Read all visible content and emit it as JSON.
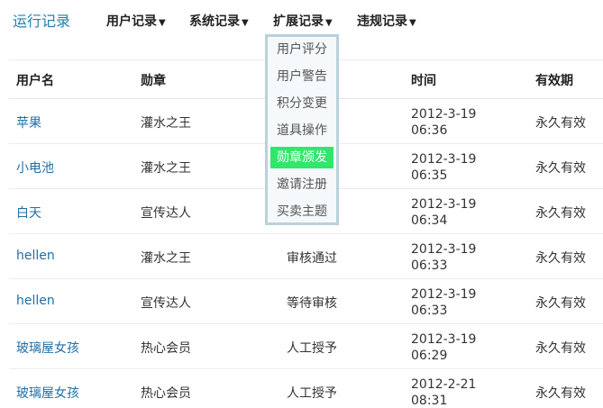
{
  "header": {
    "title": "运行记录",
    "nav": [
      {
        "label": "用户记录",
        "caret": "▼"
      },
      {
        "label": "系统记录",
        "caret": "▼"
      },
      {
        "label": "扩展记录",
        "caret": "▼"
      },
      {
        "label": "违规记录",
        "caret": "▼"
      }
    ]
  },
  "dropdown": {
    "items": [
      "用户评分",
      "用户警告",
      "积分变更",
      "道具操作",
      "勋章颁发",
      "邀请注册",
      "买卖主题"
    ],
    "active": "勋章颁发"
  },
  "table": {
    "columns": [
      "用户名",
      "勋章",
      "",
      "时间",
      "有效期"
    ],
    "rows": [
      {
        "user": "苹果",
        "medal": "灌水之王",
        "op": "",
        "date": "2012-3-19",
        "time": "06:36",
        "valid": "永久有效"
      },
      {
        "user": "小电池",
        "medal": "灌水之王",
        "op": "",
        "date": "2012-3-19",
        "time": "06:35",
        "valid": "永久有效"
      },
      {
        "user": "白天",
        "medal": "宣传达人",
        "op": "",
        "date": "2012-3-19",
        "time": "06:34",
        "valid": "永久有效"
      },
      {
        "user": "hellen",
        "medal": "灌水之王",
        "op": "审核通过",
        "date": "2012-3-19",
        "time": "06:33",
        "valid": "永久有效"
      },
      {
        "user": "hellen",
        "medal": "宣传达人",
        "op": "等待审核",
        "date": "2012-3-19",
        "time": "06:33",
        "valid": "永久有效"
      },
      {
        "user": "玻璃屋女孩",
        "medal": "热心会员",
        "op": "人工授予",
        "date": "2012-3-19",
        "time": "06:29",
        "valid": "永久有效"
      },
      {
        "user": "玻璃屋女孩",
        "medal": "热心会员",
        "op": "人工授予",
        "date": "2012-2-21",
        "time": "08:31",
        "valid": "永久有效"
      }
    ]
  },
  "colors": {
    "accent": "#1f7fb0",
    "link": "#1f6fa8",
    "dropdown_border": "#b9d1dc",
    "dropdown_active": "#2fe86a"
  }
}
